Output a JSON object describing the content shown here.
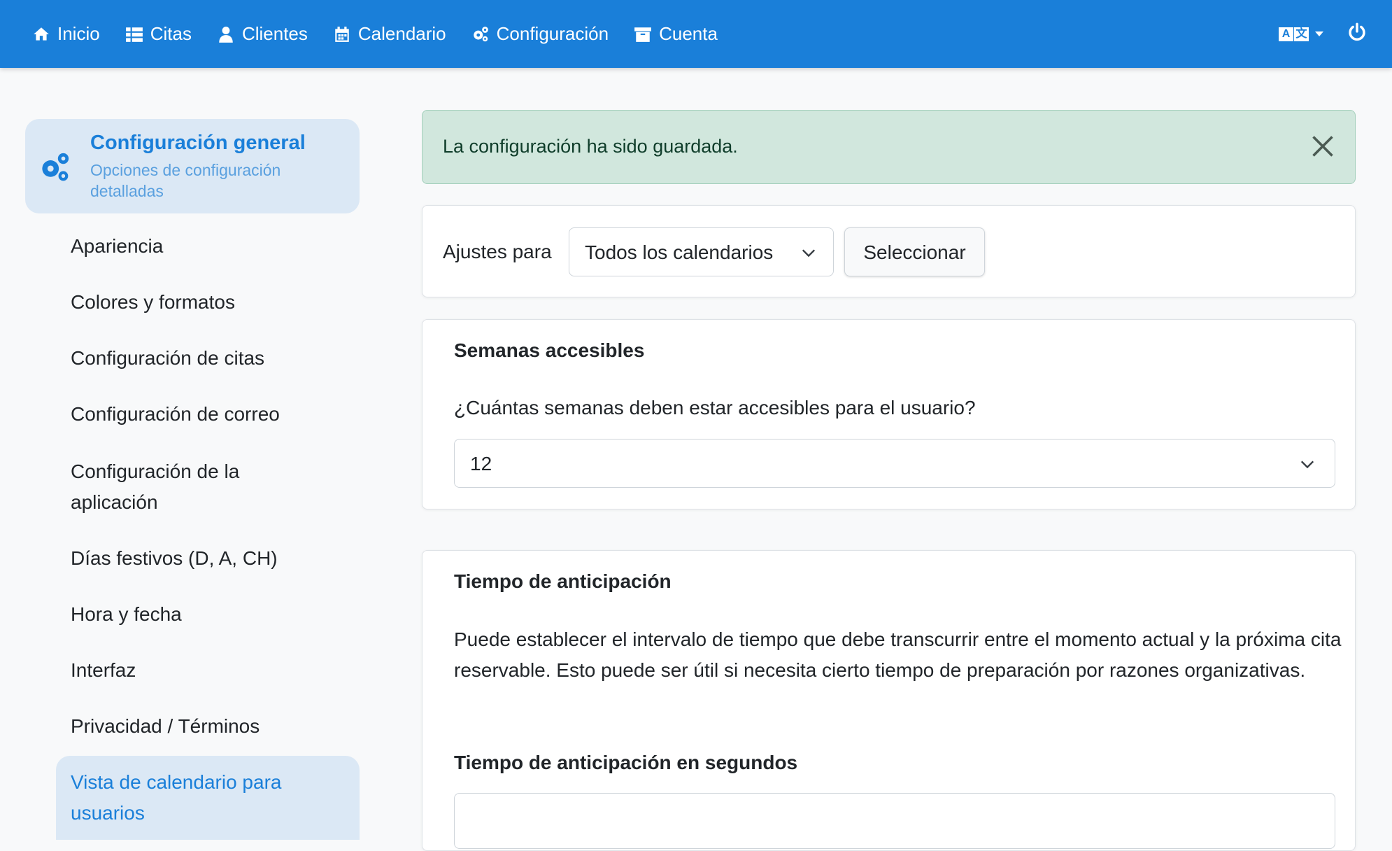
{
  "nav": {
    "items": [
      {
        "label": "Inicio",
        "icon": "home-icon"
      },
      {
        "label": "Citas",
        "icon": "list-icon"
      },
      {
        "label": "Clientes",
        "icon": "user-icon"
      },
      {
        "label": "Calendario",
        "icon": "calendar-icon"
      },
      {
        "label": "Configuración",
        "icon": "gears-icon"
      },
      {
        "label": "Cuenta",
        "icon": "archive-icon"
      }
    ],
    "lang_glyphs": [
      "A",
      "文"
    ]
  },
  "sidebar": {
    "title": "Configuración general",
    "subtitle": "Opciones de configuración detalladas",
    "items": [
      "Apariencia",
      "Colores y formatos",
      "Configuración de citas",
      "Configuración de correo",
      "Configuración de la aplicación",
      "Días festivos (D, A, CH)",
      "Hora y fecha",
      "Interfaz",
      "Privacidad / Términos"
    ],
    "active_item": "Vista de calendario para usuarios"
  },
  "alert": {
    "message": "La configuración ha sido guardada."
  },
  "settings_for": {
    "label": "Ajustes para",
    "selected_calendar": "Todos los calendarios",
    "button": "Seleccionar"
  },
  "weeks_card": {
    "title": "Semanas accesibles",
    "question": "¿Cuántas semanas deben estar accesibles para el usuario?",
    "value": "12"
  },
  "lead_time_card": {
    "title": "Tiempo de anticipación",
    "description": "Puede establecer el intervalo de tiempo que debe transcurrir entre el momento actual y la próxima cita reservable. Esto puede ser útil si necesita cierto tiempo de preparación por razones organizativas.",
    "field_label": "Tiempo de anticipación en segundos",
    "field_value": ""
  },
  "colors": {
    "navbar": "#1a7fd9",
    "accent": "#1a7fd9",
    "alert_bg": "#d1e7dd",
    "sidebar_active_bg": "#dbe8f5"
  }
}
